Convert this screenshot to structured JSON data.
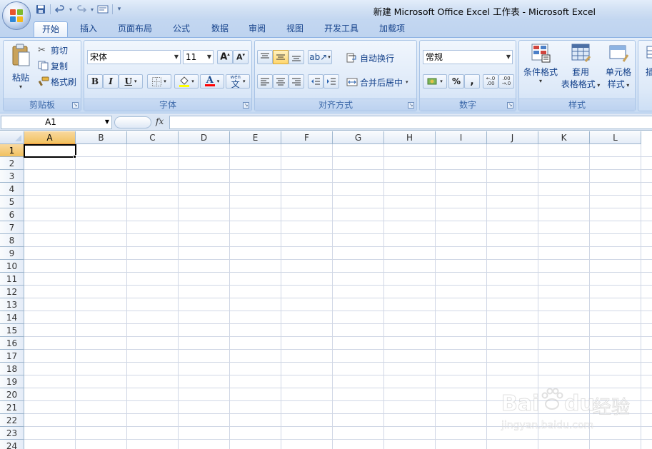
{
  "window": {
    "title": "新建 Microsoft Office Excel 工作表 - Microsoft Excel"
  },
  "quick_access": {
    "icons": [
      "save-icon",
      "undo-icon",
      "redo-icon",
      "print-preview-icon",
      "customize-icon"
    ]
  },
  "tabs": [
    "开始",
    "插入",
    "页面布局",
    "公式",
    "数据",
    "审阅",
    "视图",
    "开发工具",
    "加载项"
  ],
  "active_tab": "开始",
  "ribbon": {
    "clipboard": {
      "label": "剪贴板",
      "paste": "粘贴",
      "cut": "剪切",
      "copy": "复制",
      "format_painter": "格式刷"
    },
    "font": {
      "label": "字体",
      "font_name": "宋体",
      "font_size": "11",
      "bold": "B",
      "italic": "I",
      "underline": "U",
      "font_color_glyph": "A",
      "phonetic": "wén"
    },
    "alignment": {
      "label": "对齐方式",
      "wrap_text": "自动换行",
      "merge_center": "合并后居中"
    },
    "number": {
      "label": "数字",
      "format": "常规",
      "percent": "%",
      "comma": ","
    },
    "styles": {
      "label": "样式",
      "conditional_formatting": "条件格式",
      "format_as_table_line1": "套用",
      "format_as_table_line2": "表格格式",
      "cell_styles_line1": "单元格",
      "cell_styles_line2": "样式",
      "partial_next": "插"
    }
  },
  "formula_bar": {
    "name_box": "A1",
    "fx": "fx",
    "formula": ""
  },
  "sheet": {
    "columns": [
      "A",
      "B",
      "C",
      "D",
      "E",
      "F",
      "G",
      "H",
      "I",
      "J",
      "K",
      "L"
    ],
    "rows": [
      "1",
      "2",
      "3",
      "4",
      "5",
      "6",
      "7",
      "8",
      "9",
      "10",
      "11",
      "12",
      "13",
      "14",
      "15",
      "16",
      "17",
      "18",
      "19",
      "20",
      "21",
      "22",
      "23",
      "24"
    ],
    "selected_cell": "A1"
  },
  "watermark": {
    "brand": "Bai",
    "brand_tail": "du",
    "service": "经验",
    "url": "jingyan.baidu.com"
  },
  "colors": {
    "ribbon_bg": "#d6e4f6",
    "selection_header": "#f1c15f",
    "gridline": "#d0d7e5"
  }
}
